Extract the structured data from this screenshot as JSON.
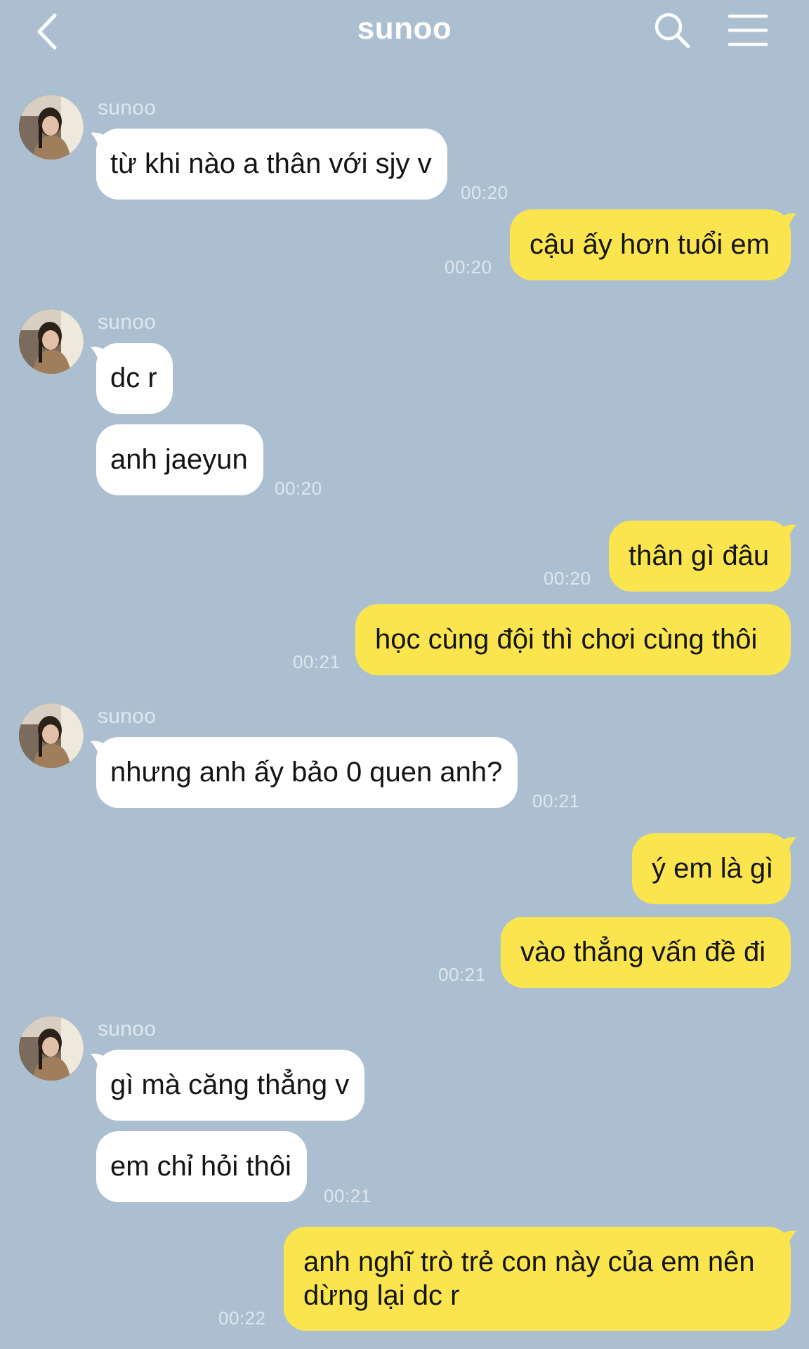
{
  "header": {
    "title": "sunoo"
  },
  "messages": {
    "g1": {
      "sender": "sunoo",
      "text1": "từ khi nào a thân với sjy v",
      "time": "00:20"
    },
    "o1": {
      "text1": "cậu ấy hơn tuổi em",
      "time": "00:20"
    },
    "g2": {
      "sender": "sunoo",
      "text1": "dc r",
      "text2": "anh jaeyun",
      "time": "00:20"
    },
    "o2": {
      "text1": "thân gì đâu",
      "time1": "00:20",
      "text2": "học cùng đội thì chơi cùng thôi",
      "time2": "00:21"
    },
    "g3": {
      "sender": "sunoo",
      "text1": "nhưng anh ấy bảo 0 quen anh?",
      "time": "00:21"
    },
    "o3": {
      "text1": "ý em là gì",
      "text2": "vào thẳng vấn đề đi",
      "time": "00:21"
    },
    "g4": {
      "sender": "sunoo",
      "text1": "gì mà căng thẳng v",
      "text2": "em chỉ hỏi thôi",
      "time": "00:21"
    },
    "o4": {
      "text1": "anh nghĩ trò trẻ con này của em nên dừng lại dc r",
      "time": "00:22"
    }
  },
  "colors": {
    "background": "#acbfd1",
    "incoming_bubble": "#ffffff",
    "outgoing_bubble": "#fae54f",
    "meta_text": "#dfe7ee"
  },
  "icons": [
    "back-arrow-icon",
    "search-icon",
    "menu-icon",
    "avatar-photo"
  ]
}
